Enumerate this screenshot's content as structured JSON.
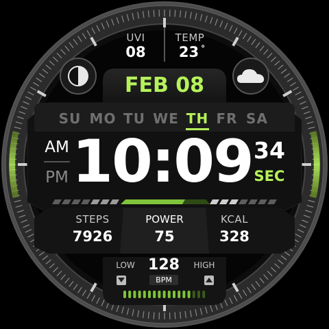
{
  "uvi": {
    "label": "UVI",
    "value": "08"
  },
  "temp": {
    "label": "TEMP",
    "value": "23",
    "unit": "°"
  },
  "date": "FEB 08",
  "weekdays": [
    "SU",
    "MO",
    "TU",
    "WE",
    "TH",
    "FR",
    "SA"
  ],
  "active_day": "TH",
  "meridiem": {
    "am": "AM",
    "pm": "PM",
    "active": "AM"
  },
  "time": {
    "hours": "10",
    "separator": ":",
    "minutes": "09"
  },
  "seconds": {
    "value": "34",
    "label": "SEC"
  },
  "stats": {
    "steps": {
      "label": "STEPS",
      "value": "7926"
    },
    "power": {
      "label": "POWER",
      "value": "75"
    },
    "kcal": {
      "label": "KCAL",
      "value": "328"
    }
  },
  "heart": {
    "low_label": "LOW",
    "high_label": "HIGH",
    "value": "128",
    "unit": "BPM"
  },
  "icons": {
    "left": "moon-phase-icon",
    "right": "cloud-icon"
  },
  "colors": {
    "accent": "#b5f25a",
    "background": "#000000",
    "panel": "#1c1c1c"
  }
}
